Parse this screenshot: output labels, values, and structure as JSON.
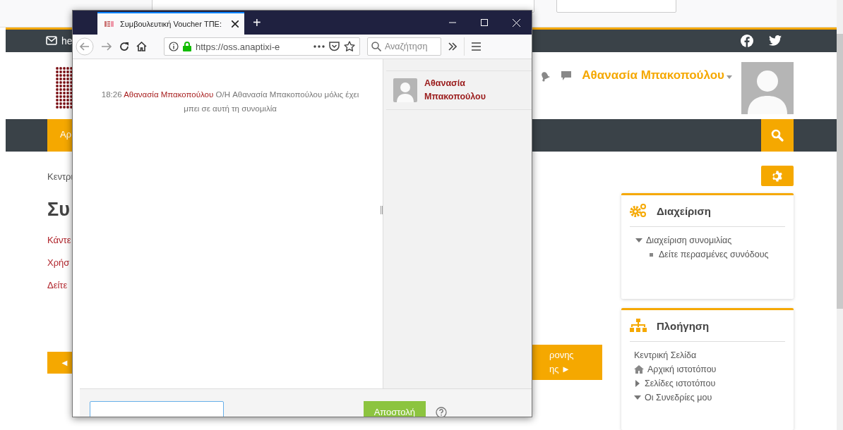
{
  "site": {
    "topbar": {
      "email_text": "he"
    },
    "user": {
      "name": "Αθανασία Μπακοπούλου"
    },
    "nav_item": "Αρ",
    "breadcrumb": "Κεντρι",
    "heading": "Συ",
    "links": [
      "Κάντε",
      "Χρήσ",
      "Δείτε"
    ],
    "prev_button": "◄",
    "next_button": [
      "ρονης",
      "ης ►"
    ],
    "blocks": [
      {
        "kind": "admin",
        "title": "Διαχείριση",
        "items": [
          {
            "kind": "branch",
            "label": "Διαχείριση συνομιλίας",
            "expanded": true,
            "children": [
              {
                "kind": "bullet",
                "label": "Δείτε περασμένες συνόδους"
              }
            ]
          }
        ]
      },
      {
        "kind": "navigation",
        "title": "Πλοήγηση",
        "items": [
          {
            "kind": "plain",
            "label": "Κεντρική Σελίδα"
          },
          {
            "kind": "home",
            "label": "Αρχική ιστοτόπου"
          },
          {
            "kind": "branch",
            "label": "Σελίδες ιστοτόπου",
            "expanded": false
          },
          {
            "kind": "branch",
            "label": "Οι Συνεδρίες μου",
            "expanded": true
          }
        ]
      }
    ]
  },
  "popup": {
    "tab_title": "Συμβουλευτική Voucher ΤΠΕ:",
    "new_tab": "+",
    "url": "https://oss.anaptixi-e",
    "search_placeholder": "Αναζήτηση",
    "messages": [
      {
        "time": "18:26",
        "author": "Αθανασία Μπακοπούλου",
        "text": "O/H Αθανασία Μπακοπούλου μόλις έχει μπει σε αυτή τη συνομιλία"
      }
    ],
    "users": [
      {
        "name": "Αθανασία Μπακοπούλου"
      }
    ],
    "send_button": "Αποστολή"
  }
}
